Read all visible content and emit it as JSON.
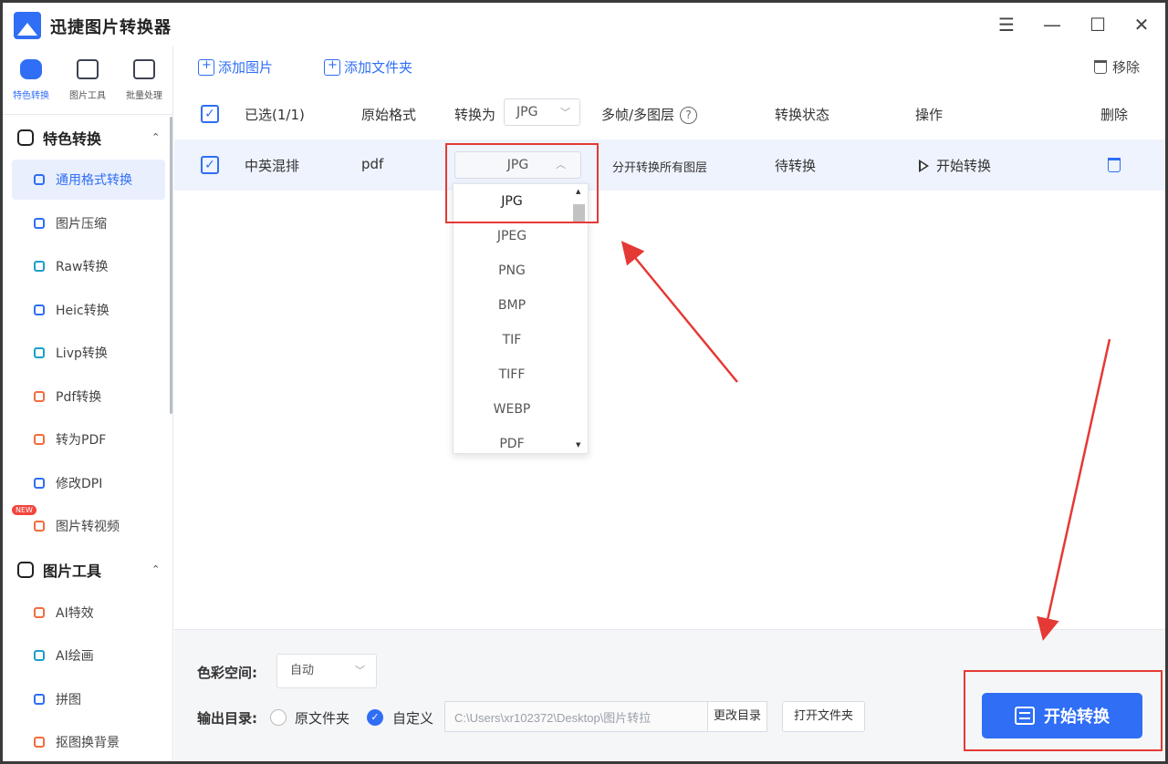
{
  "app": {
    "title": "迅捷图片转换器"
  },
  "window": {
    "menu": "☰",
    "minimize": "—",
    "maximize": "☐",
    "close": "✕"
  },
  "sidebar": {
    "top_icons": [
      {
        "label": "特色转换",
        "active": true
      },
      {
        "label": "图片工具",
        "active": false
      },
      {
        "label": "批量处理",
        "active": false
      }
    ],
    "groups": [
      {
        "label": "特色转换",
        "chevron": "⌃",
        "items": [
          {
            "label": "通用格式转换",
            "active": true
          },
          {
            "label": "图片压缩"
          },
          {
            "label": "Raw转换"
          },
          {
            "label": "Heic转换"
          },
          {
            "label": "Livp转换"
          },
          {
            "label": "Pdf转换"
          },
          {
            "label": "转为PDF"
          },
          {
            "label": "修改DPI"
          },
          {
            "label": "图片转视频",
            "badge": "NEW"
          }
        ]
      },
      {
        "label": "图片工具",
        "chevron": "⌃",
        "items": [
          {
            "label": "AI特效"
          },
          {
            "label": "AI绘画"
          },
          {
            "label": "拼图"
          },
          {
            "label": "抠图换背景"
          }
        ]
      }
    ]
  },
  "toolbar": {
    "add_image": "添加图片",
    "add_folder": "添加文件夹",
    "remove": "移除"
  },
  "table": {
    "headers": {
      "selected": "已选(1/1)",
      "source_format": "原始格式",
      "convert_to": "转换为",
      "convert_to_value": "JPG",
      "multiframe": "多帧/多图层",
      "help": "?",
      "status": "转换状态",
      "action": "操作",
      "delete": "删除"
    },
    "rows": [
      {
        "name": "中英混排",
        "format": "pdf",
        "target": "JPG",
        "multiframe": "分开转换所有图层",
        "status": "待转换",
        "action": "开始转换"
      }
    ]
  },
  "dropdown": {
    "options": [
      "JPG",
      "JPEG",
      "PNG",
      "BMP",
      "TIF",
      "TIFF",
      "WEBP",
      "PDF"
    ],
    "selected": "JPG"
  },
  "bottom": {
    "color_space_label": "色彩空间:",
    "color_space_value": "自动",
    "output_label": "输出目录:",
    "radio_original": "原文件夹",
    "radio_custom": "自定义",
    "path": "C:\\Users\\xr102372\\Desktop\\图片转拉",
    "change_dir": "更改目录",
    "open_folder": "打开文件夹",
    "start": "开始转换"
  },
  "colors": {
    "accent": "#2f6ef5",
    "annotation": "#e53935",
    "row_highlight": "#eef3fd"
  }
}
